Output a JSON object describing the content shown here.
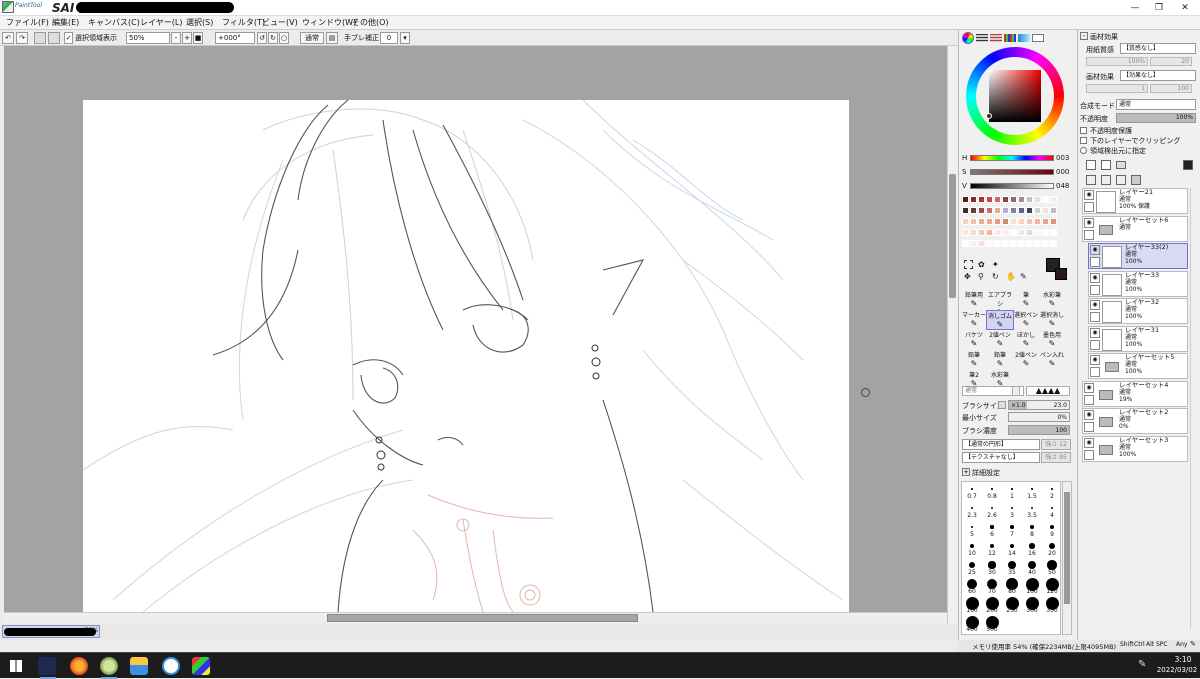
{
  "app": {
    "title": "SAI",
    "logo_small_text": "PaintTool"
  },
  "menu": [
    "ファイル(F)",
    "編集(E)",
    "キャンバス(C)",
    "レイヤー(L)",
    "選択(S)",
    "フィルタ(T)",
    "ビュー(V)",
    "ウィンドウ(W)",
    "その他(O)"
  ],
  "toolbar": {
    "show_selection_label": "選択領域表示",
    "zoom_value": "50%",
    "rotation_value": "+000°",
    "blend_mode": "通常",
    "stabilizer_label": "手ブレ補正",
    "stabilizer_value": "0"
  },
  "canvas_tab": {
    "zoom": "50%"
  },
  "color_panel": {
    "h_label": "H",
    "h_value": "003",
    "s_label": "S",
    "s_value": "000",
    "v_label": "V",
    "v_value": "048"
  },
  "tools": [
    "鉛筆用",
    "エアブラシ",
    "筆",
    "水彩筆",
    "マーカー",
    "消しゴム",
    "選択ペン",
    "選択消し",
    "バケツ",
    "2値ペン",
    "ぼかし",
    "墨色用",
    "鉛筆",
    "鉛筆",
    "2値ペン",
    "ペン入れ",
    "筆2",
    "水彩筆"
  ],
  "brush": {
    "mode": "通常",
    "size_label": "ブラシサイズ",
    "size_mult": "×1.0",
    "size_value": "23.0",
    "min_size_label": "最小サイズ",
    "min_size_value": "0%",
    "density_label": "ブラシ濃度",
    "density_value": "100",
    "shape": "【通常の円形】",
    "shape_strength": "強さ 12",
    "texture": "【テクスチャなし】",
    "texture_strength": "強さ 95",
    "detail_label": "詳細設定"
  },
  "brush_sizes": [
    "0.7",
    "0.8",
    "1",
    "1.5",
    "2",
    "2.3",
    "2.6",
    "3",
    "3.5",
    "4",
    "5",
    "6",
    "7",
    "8",
    "9",
    "10",
    "12",
    "14",
    "16",
    "20",
    "25",
    "30",
    "35",
    "40",
    "50",
    "60",
    "70",
    "80",
    "100",
    "120",
    "160",
    "200",
    "250",
    "300",
    "350",
    "400",
    "500"
  ],
  "layer_panel": {
    "section_title": "画材効果",
    "paper_label": "用紙質感",
    "paper_value": "【質感なし】",
    "paper_scale": "100%",
    "paper_strength": "20",
    "effect_label": "画材効果",
    "effect_value": "【効果なし】",
    "effect_width": "1",
    "effect_strength": "100",
    "blend_label": "合成モード",
    "blend_value": "通常",
    "opacity_label": "不透明度",
    "opacity_value": "100%",
    "opt1": "不透明度保護",
    "opt2": "下のレイヤーでクリッピング",
    "opt3": "領域検出元に指定"
  },
  "layers": [
    {
      "name": "レイヤー21",
      "mode": "通常",
      "opacity": "100% 保護",
      "type": "layer"
    },
    {
      "name": "レイヤーセット6",
      "mode": "通常",
      "opacity": "",
      "type": "folder"
    },
    {
      "name": "レイヤー33(2)",
      "mode": "通常",
      "opacity": "100%",
      "type": "layer",
      "selected": true
    },
    {
      "name": "レイヤー33",
      "mode": "通常",
      "opacity": "100%",
      "type": "layer"
    },
    {
      "name": "レイヤー32",
      "mode": "通常",
      "opacity": "100%",
      "type": "layer"
    },
    {
      "name": "レイヤー31",
      "mode": "通常",
      "opacity": "100%",
      "type": "layer"
    },
    {
      "name": "レイヤーセット5",
      "mode": "通常",
      "opacity": "100%",
      "type": "folder"
    },
    {
      "name": "レイヤーセット4",
      "mode": "通常",
      "opacity": "19%",
      "type": "folder"
    },
    {
      "name": "レイヤーセット2",
      "mode": "通常",
      "opacity": "0%",
      "type": "folder"
    },
    {
      "name": "レイヤーセット3",
      "mode": "通常",
      "opacity": "100%",
      "type": "folder"
    }
  ],
  "status": {
    "memory": "メモリ使用率 54% (確保2234MB/上限4095MB)",
    "keys": [
      "Shift",
      "Ctrl",
      "Alt",
      "SPC",
      "Any"
    ]
  },
  "taskbar": {
    "time": "3:10",
    "date": "2022/03/02"
  }
}
